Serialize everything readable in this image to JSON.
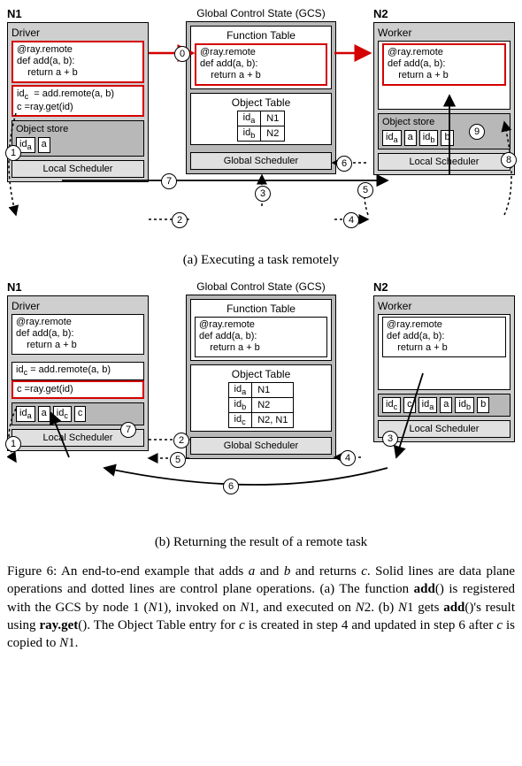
{
  "figure_number": "Figure 6:",
  "diagram_a": {
    "n1_label": "N1",
    "gcs_label": "Global Control State (GCS)",
    "n2_label": "N2",
    "driver_title": "Driver",
    "worker_title": "Worker",
    "code_decorator": "@ray.remote",
    "code_def": "def add(a, b):",
    "code_return": "    return a + b",
    "driver_call_html": "id<sub>c</sub>  = add.remote(a, b)",
    "driver_get": "c =ray.get(id)",
    "func_table_title": "Function Table",
    "obj_table_title": "Object Table",
    "obj_table_rows": [
      {
        "id": "id<sub>a</sub>",
        "loc": "N1"
      },
      {
        "id": "id<sub>b</sub>",
        "loc": "N2"
      }
    ],
    "obj_store_title": "Object store",
    "n1_store": [
      [
        "id<sub>a</sub>",
        "a"
      ]
    ],
    "n2_store": [
      [
        "id<sub>a</sub>",
        "a"
      ],
      [
        "id<sub>b</sub>",
        "b"
      ]
    ],
    "local_sched": "Local Scheduler",
    "global_sched": "Global Scheduler",
    "steps": [
      "0",
      "1",
      "2",
      "3",
      "4",
      "5",
      "6",
      "7",
      "8",
      "9"
    ],
    "caption": "(a) Executing a task remotely"
  },
  "diagram_b": {
    "n1_label": "N1",
    "gcs_label": "Global Control State (GCS)",
    "n2_label": "N2",
    "driver_title": "Driver",
    "worker_title": "Worker",
    "code_decorator": "@ray.remote",
    "code_def": "def add(a, b):",
    "code_return": "    return a + b",
    "driver_call_html": "id<sub>c</sub> = add.remote(a, b)",
    "driver_get": "c =ray.get(id)",
    "func_table_title": "Function Table",
    "obj_table_title": "Object Table",
    "obj_table_rows": [
      {
        "id": "id<sub>a</sub>",
        "loc": "N1"
      },
      {
        "id": "id<sub>b</sub>",
        "loc": "N2"
      },
      {
        "id": "id<sub>c</sub>",
        "loc": "N2, N1"
      }
    ],
    "obj_store_title": "Object store",
    "n1_store": [
      [
        "id<sub>a</sub>",
        "a"
      ],
      [
        "id<sub>c</sub>",
        "c"
      ]
    ],
    "n2_store": [
      [
        "id<sub>c</sub>",
        "c"
      ],
      [
        "id<sub>a</sub>",
        "a"
      ],
      [
        "id<sub>b</sub>",
        "b"
      ]
    ],
    "local_sched": "Local Scheduler",
    "global_sched": "Global Scheduler",
    "steps": [
      "1",
      "2",
      "3",
      "4",
      "5",
      "6",
      "7"
    ],
    "caption": "(b) Returning the result of a remote task"
  },
  "caption": {
    "lead": "An end-to-end example that adds ",
    "a": "a",
    "mid1": " and ",
    "b": "b",
    "mid2": " and returns ",
    "c": "c",
    "sent2": ".  Solid lines are data plane operations and dotted lines are control plane operations. (a) The function ",
    "add": "add",
    "sent3": "() is registered with the GCS by node 1 (",
    "N1": "N",
    "one": "1",
    "sent4": "), invoked on ",
    "sent5": ", and executed on ",
    "N2": "N",
    "two": "2",
    "sent6": ". (b) ",
    "sent7": " gets ",
    "sent8": "()'s result using ",
    "rayget": "ray.get",
    "sent9": "(). The Object Table entry for ",
    "sent10": " is created in step 4 and updated in step 6 after ",
    "sent11": " is copied to ",
    "period": "."
  }
}
